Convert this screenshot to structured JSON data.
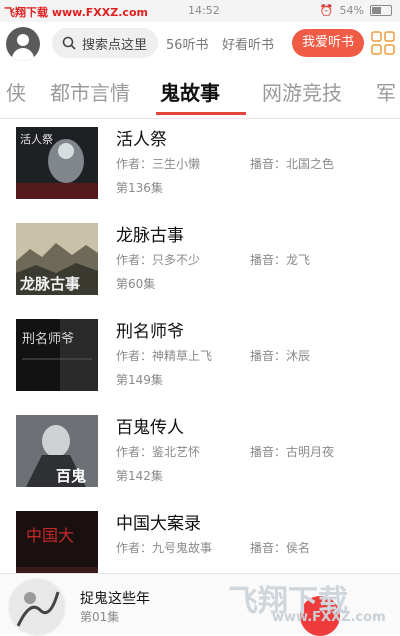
{
  "status_bar": {
    "watermark": "飞翔下载 www.FXXZ.com",
    "time": "14:52",
    "battery": "54%"
  },
  "top_bar": {
    "search_placeholder": "搜索点这里",
    "link_1": "56听书",
    "link_2": "好看听书",
    "active_pill": "我爱听书"
  },
  "tabs": [
    {
      "label": "侠"
    },
    {
      "label": "都市言情"
    },
    {
      "label": "鬼故事"
    },
    {
      "label": "网游竞技"
    },
    {
      "label": "军"
    }
  ],
  "list": [
    {
      "title": "活人祭",
      "author": "作者：三生小懒",
      "narrator": "播音：北国之色",
      "episodes": "第136集"
    },
    {
      "title": "龙脉古事",
      "author": "作者：只多不少",
      "narrator": "播音：龙飞",
      "episodes": "第60集"
    },
    {
      "title": "刑名师爷",
      "author": "作者：神精草上飞",
      "narrator": "播音：沐辰",
      "episodes": "第149集"
    },
    {
      "title": "百鬼传人",
      "author": "作者：鉴北艺怀",
      "narrator": "播音：古明月夜",
      "episodes": "第142集"
    },
    {
      "title": "中国大案录",
      "author": "作者：九号鬼故事",
      "narrator": "播音：侯名",
      "episodes": ""
    }
  ],
  "covers": [
    {
      "text": "活人祭"
    },
    {
      "text": "龙脉古事"
    },
    {
      "text": "刑名师爷"
    },
    {
      "text": "百鬼"
    },
    {
      "text": "中国大"
    }
  ],
  "player": {
    "title": "捉鬼这些年",
    "subtitle": "第01集",
    "watermark_brand": "飞翔下载",
    "watermark_url": "www.FXXZ.com"
  },
  "colors": {
    "accent": "#ef5b45",
    "tab_underline": "#e2463a"
  }
}
